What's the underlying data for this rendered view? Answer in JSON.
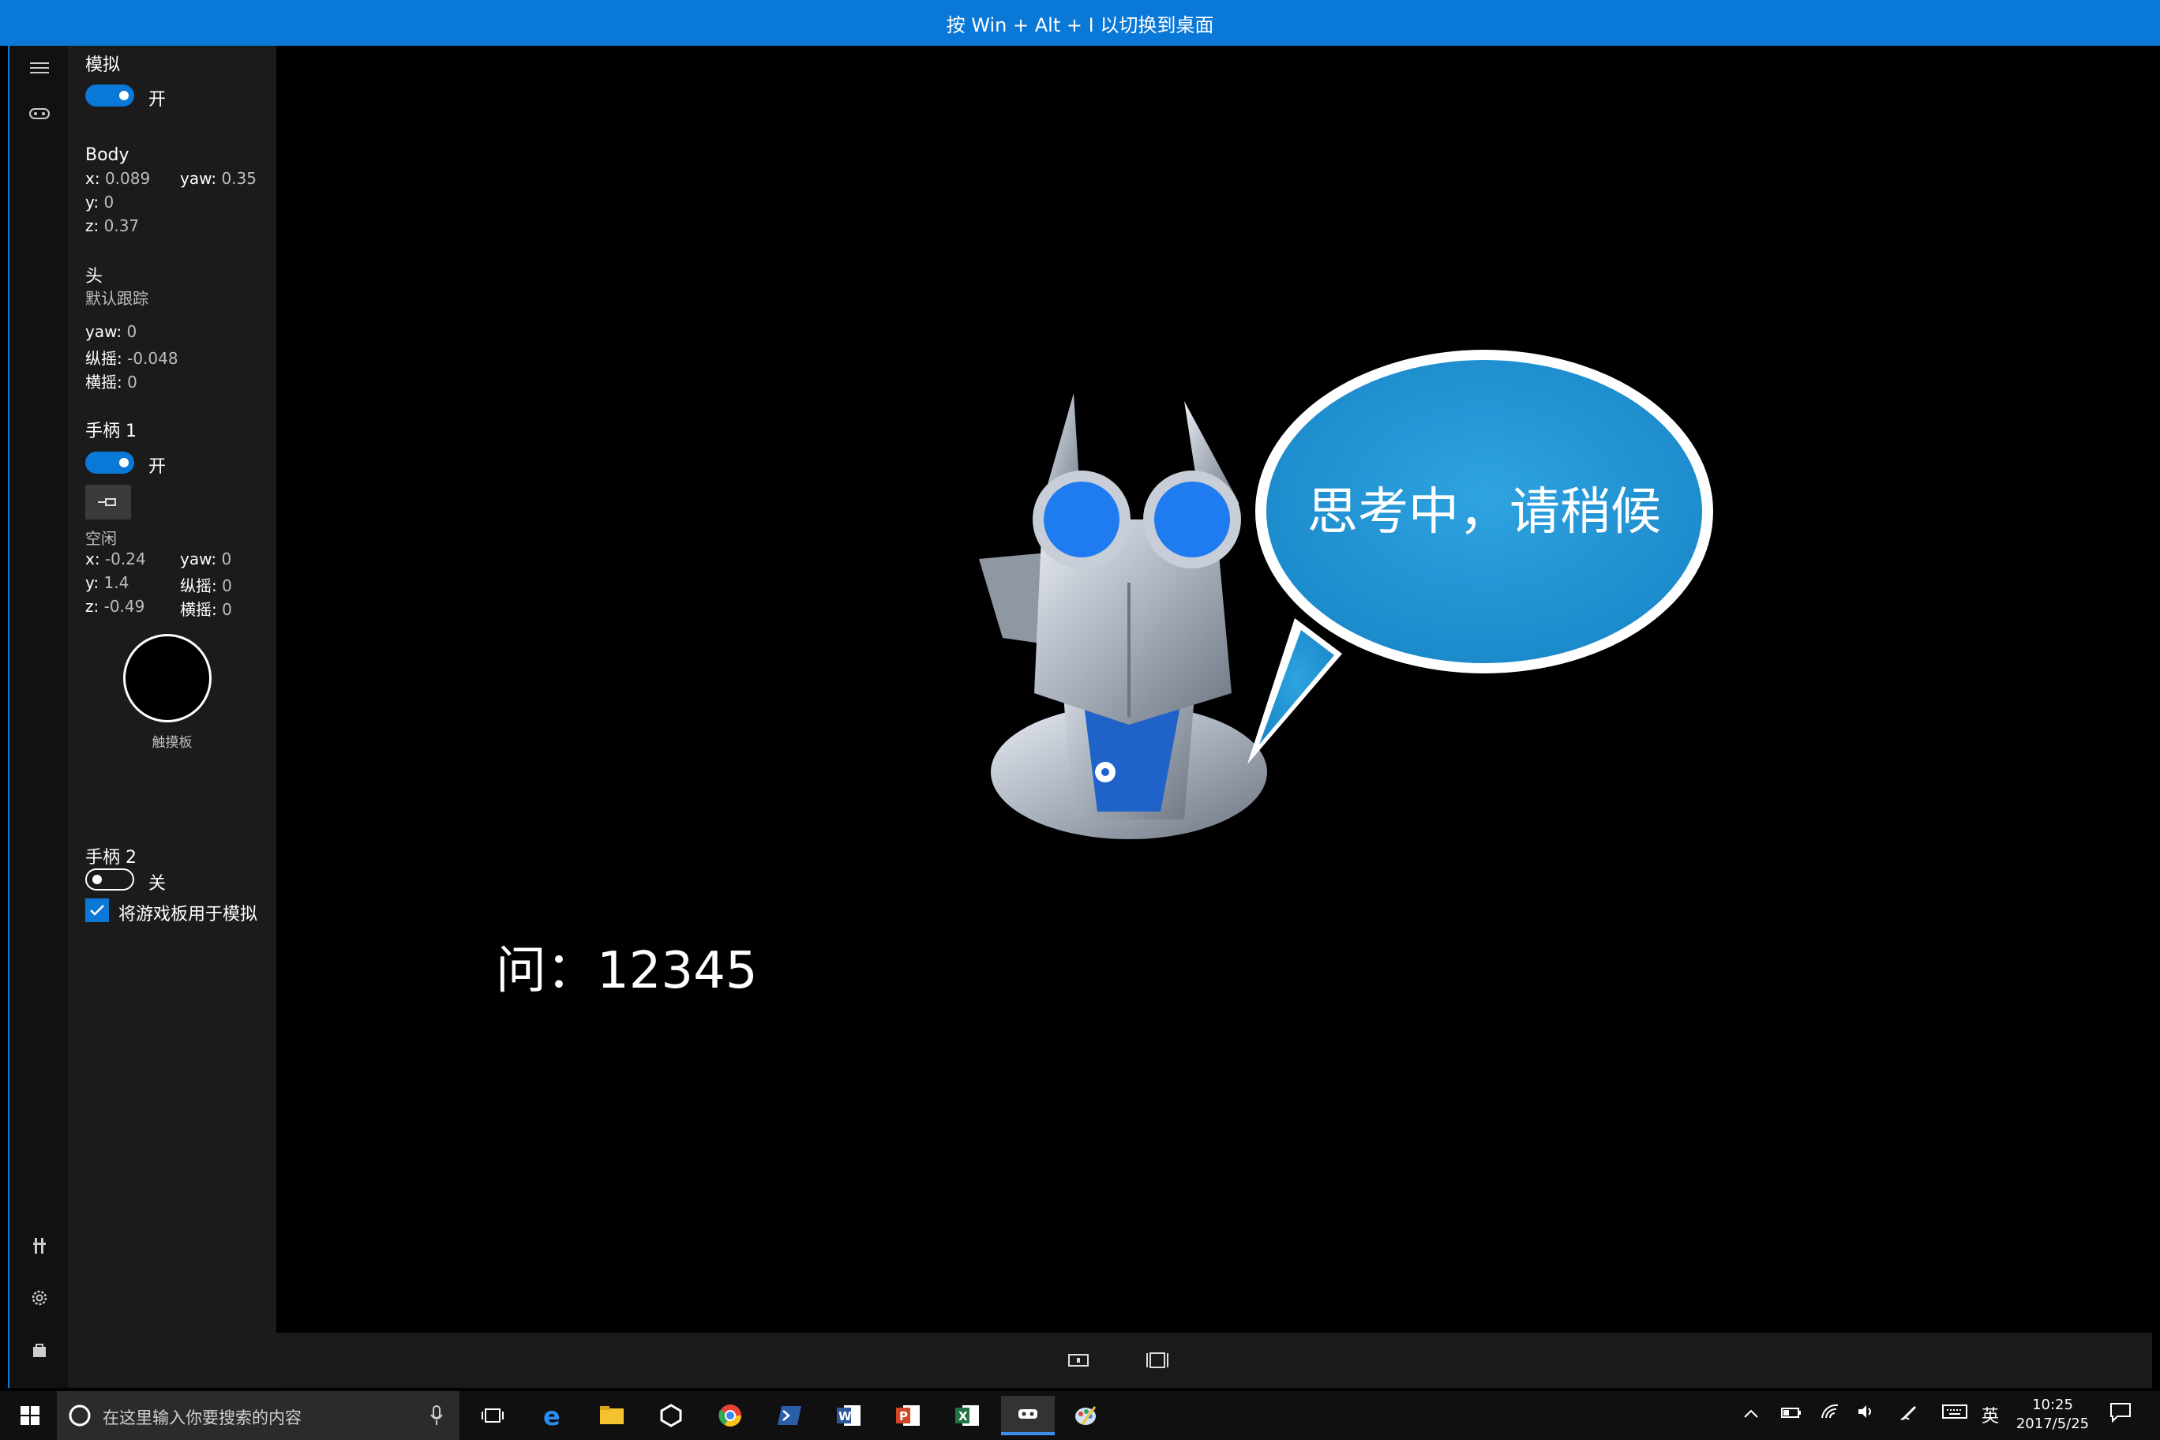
{
  "banner": {
    "text": "按 Win + Alt + I 以切换到桌面"
  },
  "panel": {
    "sim_title": "模拟",
    "sim_toggle_label": "开",
    "body": {
      "title": "Body",
      "x_key": "x:",
      "x_val": "0.089",
      "yaw_key": "yaw:",
      "yaw_val": "0.35",
      "y_key": "y:",
      "y_val": "0",
      "z_key": "z:",
      "z_val": "0.37"
    },
    "head": {
      "title": "头",
      "mode": "默认跟踪",
      "yaw_key": "yaw:",
      "yaw_val": "0",
      "pitch_key": "纵摇:",
      "pitch_val": "-0.048",
      "roll_key": "横摇:",
      "roll_val": "0"
    },
    "controller1": {
      "title": "手柄 1",
      "toggle_label": "开",
      "state": "空闲",
      "x_key": "x:",
      "x_val": "-0.24",
      "yaw_key": "yaw:",
      "yaw_val": "0",
      "y_key": "y:",
      "y_val": "1.4",
      "pitch_key": "纵摇:",
      "pitch_val": "0",
      "z_key": "z:",
      "z_val": "-0.49",
      "roll_key": "横摇:",
      "roll_val": "0",
      "touchpad_label": "触摸板"
    },
    "controller2": {
      "title": "手柄 2",
      "toggle_label": "关"
    },
    "gamepad_checkbox_label": "将游戏板用于模拟"
  },
  "viewport": {
    "speech_bubble": "思考中，请稍候",
    "question": "问：12345"
  },
  "taskbar": {
    "search_placeholder": "在这里输入你要搜索的内容",
    "ime": "英",
    "time": "10:25",
    "date": "2017/5/25"
  },
  "colors": {
    "accent": "#0a78d7",
    "panel": "#1b1b1b",
    "bubble": "#2a98d8"
  }
}
